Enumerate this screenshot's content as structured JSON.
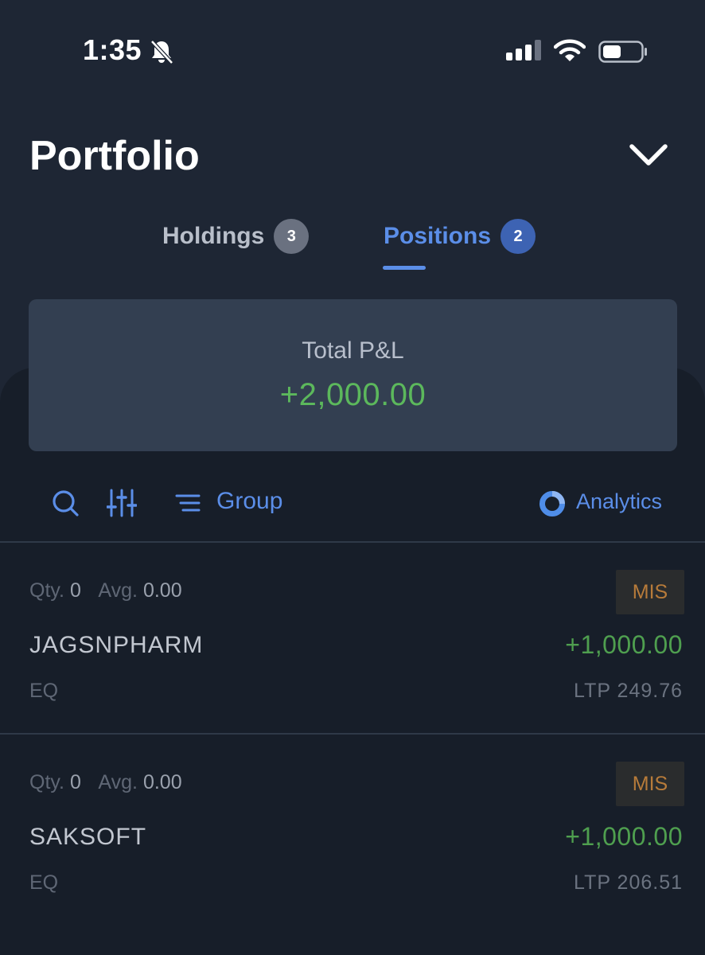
{
  "status_bar": {
    "time": "1:35",
    "icons": [
      "bell-slash-icon",
      "signal-icon",
      "wifi-icon",
      "battery-icon"
    ]
  },
  "header": {
    "title": "Portfolio",
    "collapse_icon": "chevron-down-icon"
  },
  "tabs": [
    {
      "label": "Holdings",
      "count": "3",
      "active": false
    },
    {
      "label": "Positions",
      "count": "2",
      "active": true
    }
  ],
  "summary": {
    "label": "Total P&L",
    "value": "+2,000.00"
  },
  "toolbar": {
    "icons": [
      "search-icon",
      "filter-sliders-icon",
      "list-icon",
      "analytics-ring-icon"
    ],
    "group_label": "Group",
    "analytics_label": "Analytics"
  },
  "positions": [
    {
      "qty_label": "Qty.",
      "qty": "0",
      "avg_label": "Avg.",
      "avg": "0.00",
      "product": "MIS",
      "symbol": "JAGSNPHARM",
      "pnl": "+1,000.00",
      "segment": "EQ",
      "ltp": "LTP 249.76"
    },
    {
      "qty_label": "Qty.",
      "qty": "0",
      "avg_label": "Avg.",
      "avg": "0.00",
      "product": "MIS",
      "symbol": "SAKSOFT",
      "pnl": "+1,000.00",
      "segment": "EQ",
      "ltp": "LTP 206.51"
    }
  ],
  "colors": {
    "background": "#1e2634",
    "accent_blue": "#5b8ee8",
    "profit_green": "#5cb85c",
    "mis_orange": "#b77b3a"
  }
}
